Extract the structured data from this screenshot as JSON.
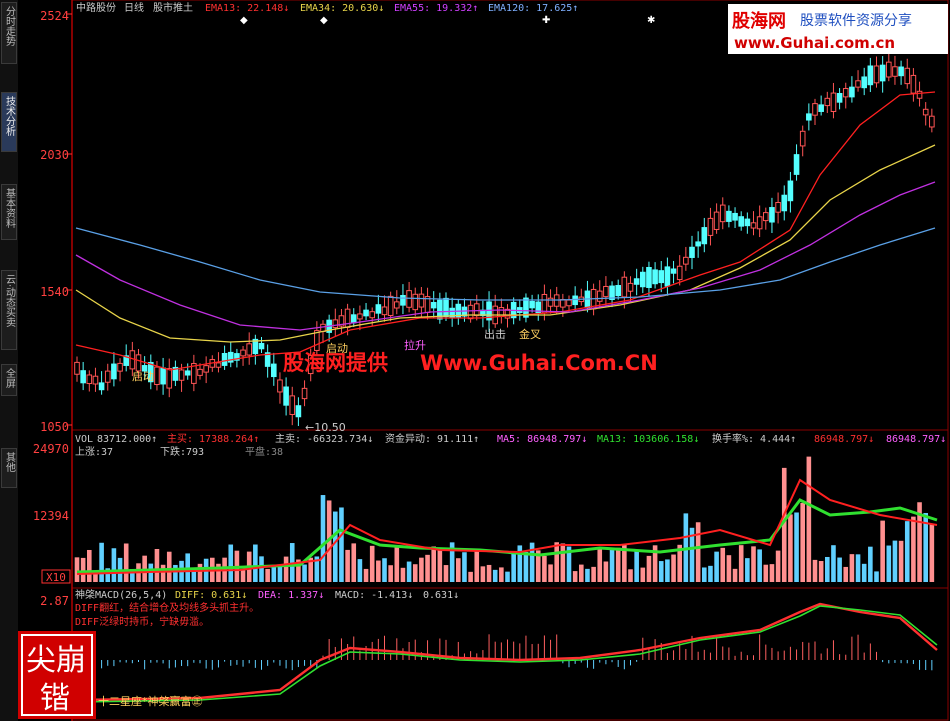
{
  "sidebar": {
    "tabs": [
      "分时走势",
      "技术分析",
      "基本资料",
      "云·动态买卖",
      "全屏",
      "其他"
    ],
    "active_index": 1
  },
  "header": {
    "stock": "中路股份",
    "period": "日线",
    "indicator_name": "股市推土",
    "ema13": "EMA13: 22.148↓",
    "ema34": "EMA34: 20.630↓",
    "ema55": "EMA55: 19.332↑",
    "ema120": "EMA120: 17.625↑"
  },
  "watermark": {
    "logo_cn": "股海网",
    "logo_tag": "股票软件资源分享",
    "logo_url": "www.Guhai.com.cn",
    "center_cn": "股海网提供",
    "center_url": "Www.Guhai.Com.CN",
    "stamp_chars": "尖崩锴"
  },
  "annotations": {
    "qidong_left": "启动",
    "qidong_mid": "启动",
    "lajing": "拉升",
    "chuji": "出击",
    "jincha": "金叉",
    "low_marker": "←10.50"
  },
  "price_axis": [
    "2524",
    "2030",
    "1540",
    "1050"
  ],
  "volume": {
    "line1_prefix": "VOL",
    "vol_value": "83712.000↑",
    "zhumai": "主买: 17388.264↑",
    "zhumai_sell": "主卖: -66323.734↓",
    "zijin": "资金异动: 91.111↑",
    "ma5": "MA5: 86948.797↓",
    "ma13": "MA13: 103606.158↓",
    "huanshou": "换手率%: 4.444↑",
    "extra1": "86948.797↓",
    "extra2": "86948.797↓",
    "shangzhang": "上涨:37",
    "xiadie": "下跌:793",
    "pingpan": "平盘:38",
    "axis": [
      "24970",
      "12394",
      "X10"
    ]
  },
  "macd": {
    "title": "神棨MACD(26,5,4)",
    "diff": "DIFF: 0.631↓",
    "dea": "DEA: 1.337↓",
    "macd": "MACD: -1.413↓",
    "extra": "0.631↓",
    "note1": "DIFF翻红，结合增仓及均线多头抓主升。",
    "note2": "DIFF泛绿时持币，宁缺毋滥。",
    "axis_top": "2.87",
    "footer": "十二星座*神棨赢富㊣"
  },
  "colors": {
    "up": "#ff5555",
    "down": "#54ffff",
    "ema13": "#ff2020",
    "ema34": "#e8d44a",
    "ema55": "#c030e0",
    "ema120": "#5aa0e6",
    "axis": "#b00000"
  }
}
